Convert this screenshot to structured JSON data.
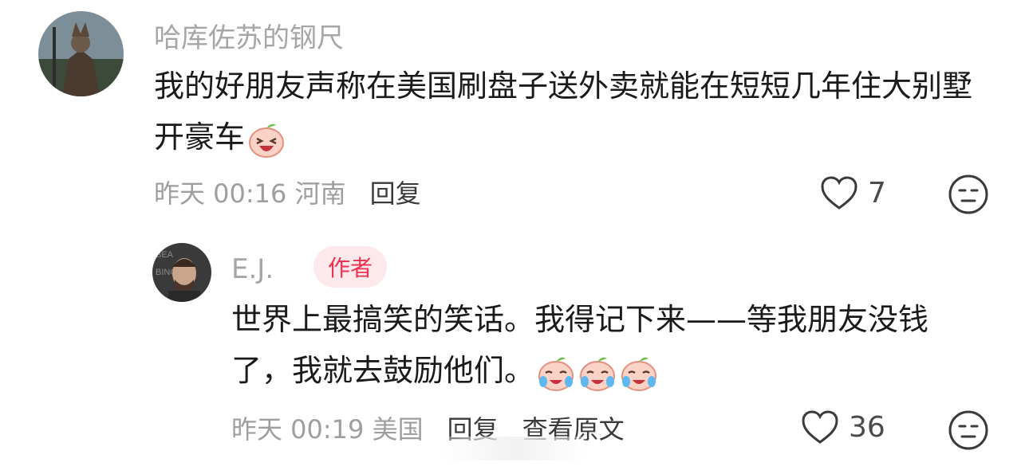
{
  "comments": [
    {
      "username": "哈库佐苏的钢尺",
      "text": "我的好朋友声称在美国刷盘子送外卖就能在短短几年住大别墅开豪车",
      "emoji_count": 1,
      "time": "昨天 00:16",
      "location": "河南",
      "reply_label": "回复",
      "likes": "7",
      "colors": {
        "avatar_bg": "#3e4a53"
      }
    },
    {
      "username": "E.J.",
      "author_badge": "作者",
      "text": "世界上最搞笑的笑话。我得记下来——等我朋友没钱了，我就去鼓励他们。",
      "emoji_count": 3,
      "time": "昨天 00:19",
      "location": "美国",
      "reply_label": "回复",
      "view_original_label": "查看原文",
      "likes": "36",
      "colors": {
        "avatar_bg": "#2b2b2b"
      }
    }
  ],
  "colors": {
    "badge_text": "#f0304e",
    "badge_bg": "#fde8ec",
    "meta": "#9e9e9e"
  }
}
